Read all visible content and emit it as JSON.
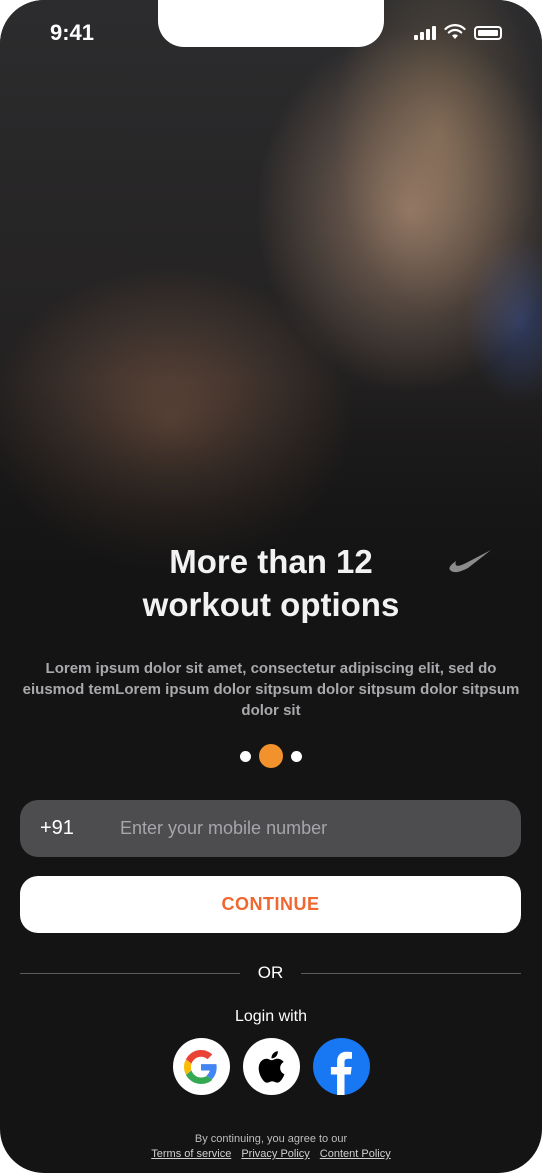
{
  "status_bar": {
    "time": "9:41"
  },
  "onboarding": {
    "headline_line1": "More than 12",
    "headline_line2": "workout options",
    "description": "Lorem ipsum dolor sit amet, consectetur adipiscing elit, sed do eiusmod temLorem ipsum dolor sitpsum dolor sitpsum dolor sitpsum dolor sit",
    "pagination": {
      "total": 3,
      "active": 2
    }
  },
  "form": {
    "country_code": "+91",
    "phone_placeholder": "Enter your mobile number",
    "phone_value": "",
    "continue_label": "CONTINUE"
  },
  "divider": {
    "label": "OR"
  },
  "social_login": {
    "title": "Login with",
    "providers": [
      "google-icon",
      "apple-icon",
      "facebook-icon"
    ]
  },
  "legal": {
    "notice": "By continuing, you agree to our",
    "links": [
      "Terms of service",
      "Privacy Policy",
      "Content Policy"
    ]
  },
  "colors": {
    "accent": "#f2922c",
    "continue_text": "#f0672f",
    "facebook": "#1877f2",
    "field_bg": "#4d4d50",
    "background": "#141414"
  }
}
